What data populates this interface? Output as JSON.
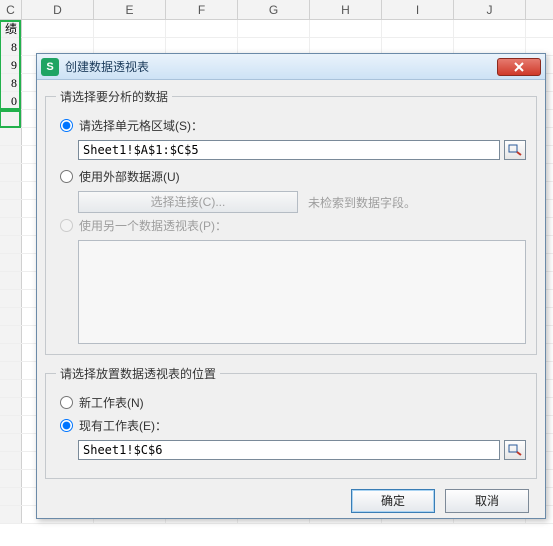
{
  "columns": [
    "C",
    "D",
    "E",
    "F",
    "G",
    "H",
    "I",
    "J"
  ],
  "cells_col0": [
    "绩",
    "8",
    "9",
    "8",
    "0"
  ],
  "dialog": {
    "title": "创建数据透视表",
    "close_label": "关闭",
    "group1": {
      "legend": "请选择要分析的数据",
      "opt_range": "请选择单元格区域(S)：",
      "range_value": "Sheet1!$A$1:$C$5",
      "opt_external": "使用外部数据源(U)",
      "choose_conn": "选择连接(C)...",
      "no_conn_note": "未检索到数据字段。",
      "opt_another_pivot": "使用另一个数据透视表(P)："
    },
    "group2": {
      "legend": "请选择放置数据透视表的位置",
      "opt_newsheet": "新工作表(N)",
      "opt_existing": "现有工作表(E)：",
      "location_value": "Sheet1!$C$6"
    },
    "buttons": {
      "ok": "确定",
      "cancel": "取消"
    }
  }
}
